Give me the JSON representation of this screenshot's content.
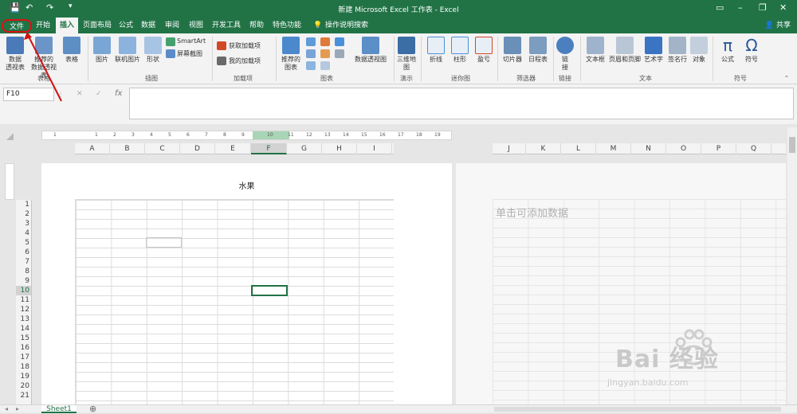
{
  "window": {
    "title": "新建 Microsoft Excel 工作表 - Excel"
  },
  "tabs": [
    {
      "label": "文件",
      "key": "file"
    },
    {
      "label": "开始",
      "key": "home"
    },
    {
      "label": "插入",
      "key": "insert"
    },
    {
      "label": "页面布局",
      "key": "pagelayout"
    },
    {
      "label": "公式",
      "key": "formulas"
    },
    {
      "label": "数据",
      "key": "data"
    },
    {
      "label": "审阅",
      "key": "review"
    },
    {
      "label": "视图",
      "key": "view"
    },
    {
      "label": "开发工具",
      "key": "developer"
    },
    {
      "label": "帮助",
      "key": "help"
    },
    {
      "label": "特色功能",
      "key": "special"
    },
    {
      "label": "操作说明搜索",
      "key": "tellme"
    }
  ],
  "share_label": "共享",
  "ribbon": {
    "tables": {
      "pivot": "数据\n透视表",
      "rec_pivot": "推荐的\n数据透视表",
      "table": "表格",
      "group": "表格"
    },
    "illustrations": {
      "pictures": "图片",
      "online_pictures": "联机图片",
      "shapes": "形状",
      "smartart": "SmartArt",
      "screenshot": "屏幕截图",
      "group": "插图"
    },
    "addins": {
      "get": "获取加载项",
      "my": "我的加载项",
      "group": "加载项"
    },
    "charts": {
      "recommended": "推荐的\n图表",
      "pivotchart": "数据透视图",
      "group": "图表"
    },
    "tours": {
      "map3d": "三维地\n图",
      "group": "演示"
    },
    "sparklines": {
      "line": "折线",
      "column": "柱形",
      "winloss": "盈亏",
      "group": "迷你图"
    },
    "filters": {
      "slicer": "切片器",
      "timeline": "日程表",
      "group": "筛选器"
    },
    "links": {
      "link": "链\n接",
      "group": "链接"
    },
    "text": {
      "textbox": "文本框",
      "header_footer": "页眉和页脚",
      "wordart": "艺术字",
      "signature": "签名行",
      "object": "对象",
      "group": "文本"
    },
    "symbols": {
      "equation": "公式",
      "symbol": "符号",
      "group": "符号"
    }
  },
  "formula_bar": {
    "name_box": "F10",
    "fx": "fx",
    "value": ""
  },
  "ruler_marks": [
    "1",
    "1",
    "2",
    "3",
    "4",
    "5",
    "6",
    "7",
    "8",
    "9",
    "10",
    "11",
    "12",
    "13",
    "14",
    "15",
    "16",
    "17",
    "18",
    "19"
  ],
  "columns": [
    "A",
    "B",
    "C",
    "D",
    "E",
    "F",
    "G",
    "H",
    "I",
    "J",
    "K",
    "L",
    "M",
    "N",
    "O",
    "P",
    "Q"
  ],
  "selected_column": "F",
  "rows": [
    "1",
    "2",
    "3",
    "4",
    "5",
    "6",
    "7",
    "8",
    "9",
    "10",
    "11",
    "12",
    "13",
    "14",
    "15",
    "16",
    "17",
    "18",
    "19",
    "20",
    "21"
  ],
  "selected_row": "10",
  "page": {
    "header_text": "水果",
    "add_data_hint": "单击可添加数据"
  },
  "sheet_tab": "Sheet1",
  "watermark": {
    "brand": "Bai 经验",
    "url": "jingyan.baidu.com"
  },
  "colors": {
    "accent": "#217346",
    "annotation": "#d11111"
  }
}
